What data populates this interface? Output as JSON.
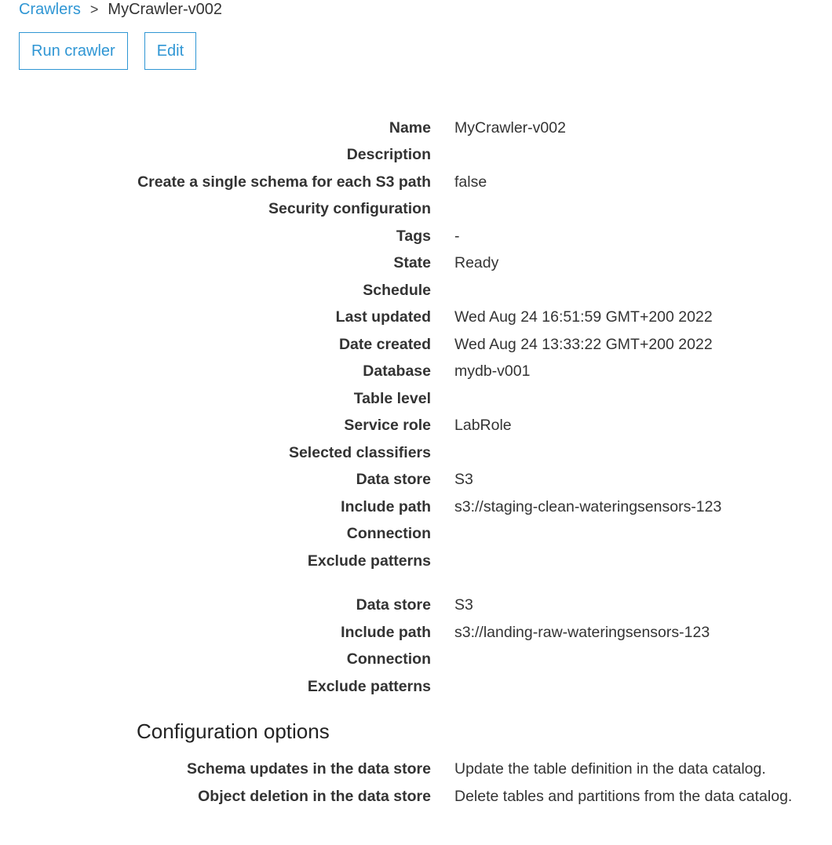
{
  "breadcrumb": {
    "parent": "Crawlers",
    "separator": ">",
    "current": "MyCrawler-v002"
  },
  "buttons": {
    "run": "Run crawler",
    "edit": "Edit"
  },
  "details": [
    {
      "label": "Name",
      "value": "MyCrawler-v002"
    },
    {
      "label": "Description",
      "value": ""
    },
    {
      "label": "Create a single schema for each S3 path",
      "value": "false"
    },
    {
      "label": "Security configuration",
      "value": ""
    },
    {
      "label": "Tags",
      "value": "-"
    },
    {
      "label": "State",
      "value": "Ready"
    },
    {
      "label": "Schedule",
      "value": ""
    },
    {
      "label": "Last updated",
      "value": "Wed Aug 24 16:51:59 GMT+200 2022"
    },
    {
      "label": "Date created",
      "value": "Wed Aug 24 13:33:22 GMT+200 2022"
    },
    {
      "label": "Database",
      "value": "mydb-v001"
    },
    {
      "label": "Table level",
      "value": ""
    },
    {
      "label": "Service role",
      "value": "LabRole"
    },
    {
      "label": "Selected classifiers",
      "value": ""
    }
  ],
  "data_stores": [
    [
      {
        "label": "Data store",
        "value": "S3"
      },
      {
        "label": "Include path",
        "value": "s3://staging-clean-wateringsensors-123"
      },
      {
        "label": "Connection",
        "value": ""
      },
      {
        "label": "Exclude patterns",
        "value": ""
      }
    ],
    [
      {
        "label": "Data store",
        "value": "S3"
      },
      {
        "label": "Include path",
        "value": "s3://landing-raw-wateringsensors-123"
      },
      {
        "label": "Connection",
        "value": ""
      },
      {
        "label": "Exclude patterns",
        "value": ""
      }
    ]
  ],
  "config": {
    "title": "Configuration options",
    "items": [
      {
        "label": "Schema updates in the data store",
        "value": "Update the table definition in the data catalog."
      },
      {
        "label": "Object deletion in the data store",
        "value": "Delete tables and partitions from the data catalog."
      }
    ]
  }
}
